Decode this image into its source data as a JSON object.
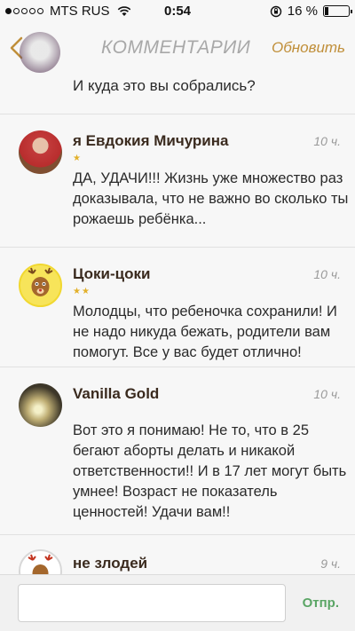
{
  "status_bar": {
    "carrier": "MTS RUS",
    "time": "0:54",
    "battery": "16 %",
    "battery_level_fraction": 0.16
  },
  "nav": {
    "title": "КОММЕНТАРИИ",
    "refresh_label": "Обновить"
  },
  "first_comment": {
    "text": "И куда это вы собрались?"
  },
  "comments": [
    {
      "author": "я Евдокия Мичурина",
      "time": "10 ч.",
      "stars": "★",
      "text": "ДА, УДАЧИ!!! Жизнь уже множество раз доказывала, что не важно во сколько ты рожаешь ребёнка..."
    },
    {
      "author": "Цоки-цоки",
      "time": "10 ч.",
      "stars": "★★",
      "text": "Молодцы, что ребеночка сохранили! И не надо никуда бежать, родители вам помогут. Все у вас будет отлично!"
    },
    {
      "author": "Vanilla Gold",
      "time": "10 ч.",
      "stars": "",
      "text": "Вот это я понимаю! Не то, что в 25 бегают аборты делать и никакой ответственности!! И в 17 лет могут быть умнее! Возраст не показатель ценностей! Удачи вам!!"
    },
    {
      "author": "не злодей",
      "time": "9 ч.",
      "stars": "",
      "text": ""
    }
  ],
  "input": {
    "placeholder": "",
    "send_label": "Отпр."
  },
  "colors": {
    "accent": "#c08f3a",
    "send": "#5aa565",
    "star": "#e2b02a"
  }
}
